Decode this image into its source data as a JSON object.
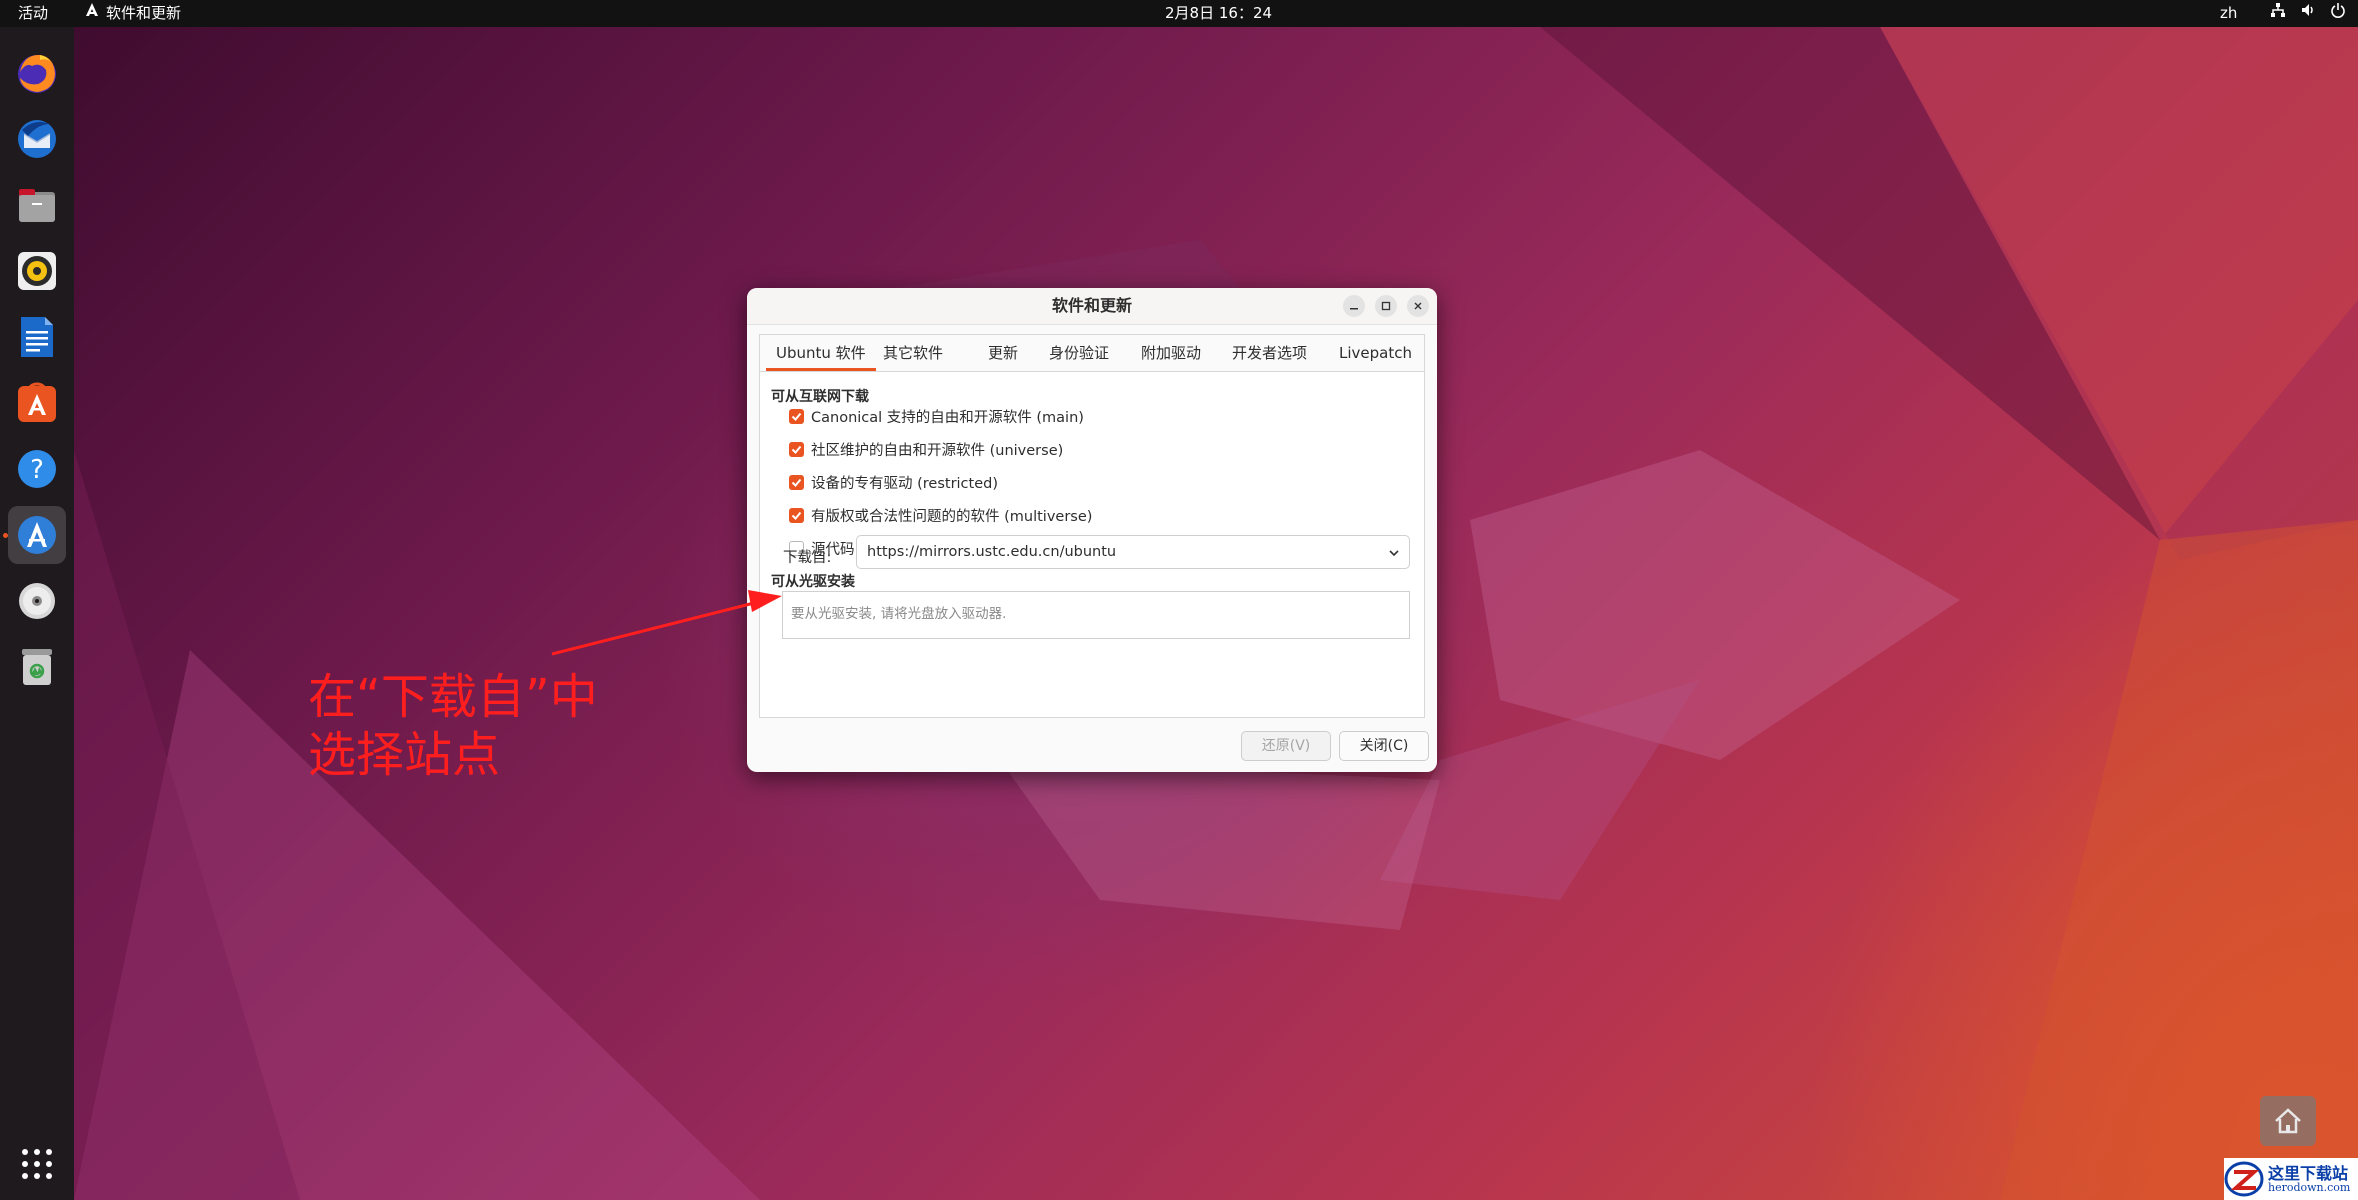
{
  "topbar": {
    "activities": "活动",
    "app_name": "软件和更新",
    "clock": "2月8日 16：24",
    "language": "zh"
  },
  "dock": {
    "items": [
      "firefox-icon",
      "thunderbird-icon",
      "files-icon",
      "rhythmbox-icon",
      "libreoffice-writer-icon",
      "ubuntu-software-icon",
      "help-icon",
      "software-updater-icon",
      "dvd-icon",
      "trash-icon"
    ],
    "active_index": 7,
    "apps_grid": "show-applications-icon"
  },
  "dialog": {
    "title": "软件和更新",
    "tabs": [
      "Ubuntu 软件",
      "其它软件",
      "更新",
      "身份验证",
      "附加驱动",
      "开发者选项",
      "Livepatch"
    ],
    "active_tab": 0,
    "internet_section": "可从互联网下载",
    "components": [
      {
        "label": "Canonical 支持的自由和开源软件 (main)",
        "checked": true
      },
      {
        "label": "社区维护的自由和开源软件 (universe)",
        "checked": true
      },
      {
        "label": "设备的专有驱动 (restricted)",
        "checked": true
      },
      {
        "label": "有版权或合法性问题的的软件 (multiverse)",
        "checked": true
      },
      {
        "label": "源代码",
        "checked": false
      }
    ],
    "download_from_label": "下载自:",
    "download_from_value": "https://mirrors.ustc.edu.cn/ubuntu",
    "cdrom_section": "可从光驱安装",
    "cdrom_placeholder": "要从光驱安装, 请将光盘放入驱动器.",
    "revert_button": "还原(V)",
    "close_button": "关闭(C)"
  },
  "annotation": {
    "line1": "在“下载自”中",
    "line2": "选择站点",
    "color": "#ff1e1e"
  },
  "watermark": {
    "line1": "这里下载站",
    "line2": "herodown.com"
  },
  "colors": {
    "accent": "#e95420",
    "topbar": "#121212",
    "dock": "#1f1a1e"
  }
}
